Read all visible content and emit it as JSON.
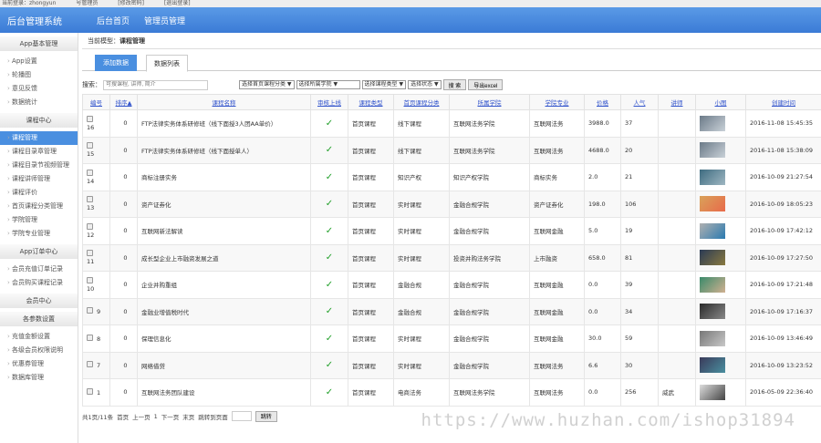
{
  "topbar": {
    "login": "当前登录：zhongyun",
    "role": "号管理员",
    "change_pwd": "[修改密码]",
    "logout": "[退出登录]"
  },
  "header": {
    "title": "后台管理系统",
    "nav": [
      "后台首页",
      "管理员管理"
    ]
  },
  "sidebar": {
    "g1": "App基本管理",
    "g1_items": [
      "App设置",
      "轮播图",
      "意见反馈",
      "数据统计"
    ],
    "g2": "课程中心",
    "g2_items": [
      "课程管理",
      "课程目录章管理",
      "课程目录节视频管理",
      "课程讲师管理",
      "课程评价",
      "首页课程分类管理",
      "学院管理",
      "学院专业管理"
    ],
    "g3": "App订单中心",
    "g3_items": [
      "会员充值订单记录",
      "会员购买课程记录"
    ],
    "g4": "会员中心",
    "g5": "各参数设置",
    "g5_items": [
      "充值金额设置",
      "各级会员权限说明",
      "优惠券管理",
      "数据库管理"
    ]
  },
  "breadcrumb": {
    "label": "当前模型：",
    "value": "课程管理"
  },
  "tabs": {
    "add": "添加数据",
    "list": "数据列表"
  },
  "search": {
    "label": "搜索：",
    "placeholder": "可搜课程, 讲师, 简介",
    "cat": "选择首页课程分类 ▼",
    "college": "选择所属学院 ▼",
    "type": "选择课程类型 ▼",
    "status": "选择状态 ▼",
    "search_btn": "搜 索",
    "export_btn": "导出excel"
  },
  "table": {
    "headers": [
      "编号",
      "排序▲",
      "课程名称",
      "审核上线",
      "课程类型",
      "首页课程分类",
      "所属学院",
      "学院专业",
      "价格",
      "人气",
      "讲师",
      "小图",
      "创建时间"
    ],
    "rows": [
      [
        "16",
        "0",
        "FTP法律实务体系研修班（线下面授3人团AA单价）",
        "✓",
        "首页课程",
        "线下课程",
        "互联网法务学院",
        "互联网法务",
        "3988.0",
        "37",
        "",
        "2016-11-08 15:45:35"
      ],
      [
        "15",
        "0",
        "FTP法律实务体系研修班（线下面授单人）",
        "✓",
        "首页课程",
        "线下课程",
        "互联网法务学院",
        "互联网法务",
        "4688.0",
        "20",
        "",
        "2016-11-08 15:38:09"
      ],
      [
        "14",
        "0",
        "商标注册实务",
        "✓",
        "首页课程",
        "知识产权",
        "知识产权学院",
        "商标实务",
        "2.0",
        "21",
        "",
        "2016-10-09 21:27:54"
      ],
      [
        "13",
        "0",
        "资产证券化",
        "✓",
        "首页课程",
        "实时课程",
        "金融合规学院",
        "资产证券化",
        "198.0",
        "106",
        "",
        "2016-10-09 18:05:23"
      ],
      [
        "12",
        "0",
        "互联网新法解读",
        "✓",
        "首页课程",
        "实时课程",
        "金融合规学院",
        "互联网金融",
        "5.0",
        "19",
        "",
        "2016-10-09 17:42:12"
      ],
      [
        "11",
        "0",
        "成长型企业上市融资发展之道",
        "✓",
        "首页课程",
        "实时课程",
        "投资并购法务学院",
        "上市融资",
        "658.0",
        "81",
        "",
        "2016-10-09 17:27:50"
      ],
      [
        "10",
        "0",
        "企业并购重组",
        "✓",
        "首页课程",
        "金融合规",
        "金融合规学院",
        "互联网金融",
        "0.0",
        "39",
        "",
        "2016-10-09 17:21:48"
      ],
      [
        "9",
        "0",
        "金融业增值税时代",
        "✓",
        "首页课程",
        "金融合规",
        "金融合规学院",
        "互联网金融",
        "0.0",
        "34",
        "",
        "2016-10-09 17:16:37"
      ],
      [
        "8",
        "0",
        "保理信息化",
        "✓",
        "首页课程",
        "实时课程",
        "金融合规学院",
        "互联网金融",
        "30.0",
        "59",
        "",
        "2016-10-09 13:46:49"
      ],
      [
        "7",
        "0",
        "网络借贷",
        "✓",
        "首页课程",
        "实时课程",
        "金融合规学院",
        "互联网法务",
        "6.6",
        "30",
        "",
        "2016-10-09 13:23:52"
      ],
      [
        "1",
        "0",
        "互联网法务团队建设",
        "✓",
        "首页课程",
        "电商法务",
        "互联网法务学院",
        "互联网法务",
        "0.0",
        "256",
        "威武",
        "2016-05-09 22:36:40"
      ]
    ]
  },
  "thumb_colors": [
    [
      "#6b7a88",
      "#c9d1d8"
    ],
    [
      "#6b7a88",
      "#c9d1d8"
    ],
    [
      "#3d6b80",
      "#9fb7c2"
    ],
    [
      "#d9a25a",
      "#e86a4a"
    ],
    [
      "#b0b0b0",
      "#2a7ab0"
    ],
    [
      "#2a3a55",
      "#8a7a40"
    ],
    [
      "#3a8a6a",
      "#d0b090"
    ],
    [
      "#2a2a2a",
      "#888888"
    ],
    [
      "#777777",
      "#c8c8c8"
    ],
    [
      "#3a3a5a",
      "#4a90a0"
    ],
    [
      "#dddddd",
      "#444444"
    ]
  ],
  "pager": {
    "summary": "共1页/11条",
    "first": "首页",
    "prev": "上一页",
    "page": "1",
    "next": "下一页",
    "last": "末页",
    "goto": "跳转到页面",
    "go_btn": "跳转"
  },
  "watermark": "https://www.huzhan.com/ishop31894"
}
